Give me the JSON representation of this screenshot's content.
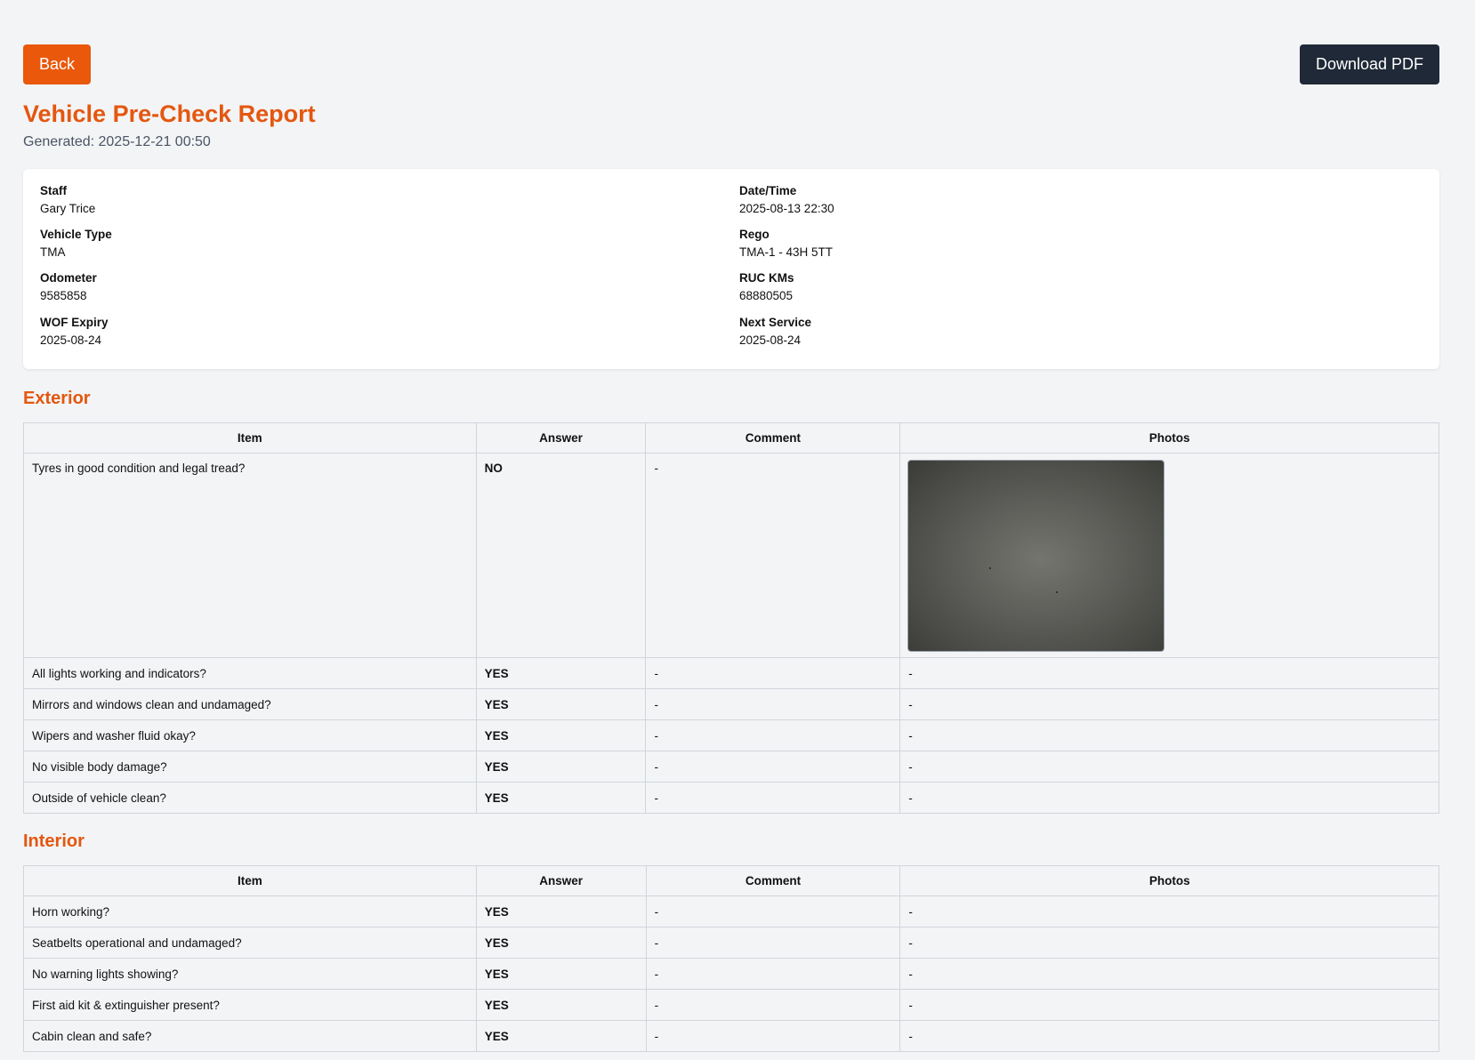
{
  "buttons": {
    "back": "Back",
    "download": "Download PDF"
  },
  "report": {
    "title": "Vehicle Pre-Check Report",
    "generated": "Generated: 2025-12-21 00:50"
  },
  "info": [
    {
      "label": "Staff",
      "value": "Gary Trice"
    },
    {
      "label": "Date/Time",
      "value": "2025-08-13 22:30"
    },
    {
      "label": "Vehicle Type",
      "value": "TMA"
    },
    {
      "label": "Rego",
      "value": "TMA-1 - 43H 5TT"
    },
    {
      "label": "Odometer",
      "value": "9585858"
    },
    {
      "label": "RUC KMs",
      "value": "68880505"
    },
    {
      "label": "WOF Expiry",
      "value": "2025-08-24"
    },
    {
      "label": "Next Service",
      "value": "2025-08-24"
    }
  ],
  "columns": [
    "Item",
    "Answer",
    "Comment",
    "Photos"
  ],
  "exterior": {
    "title": "Exterior",
    "rows": [
      {
        "item": "Tyres in good condition and legal tread?",
        "answer": "NO",
        "comment": "-",
        "photos": ""
      },
      {
        "item": "All lights working and indicators?",
        "answer": "YES",
        "comment": "-",
        "photos": "-"
      },
      {
        "item": "Mirrors and windows clean and undamaged?",
        "answer": "YES",
        "comment": "-",
        "photos": "-"
      },
      {
        "item": "Wipers and washer fluid okay?",
        "answer": "YES",
        "comment": "-",
        "photos": "-"
      },
      {
        "item": "No visible body damage?",
        "answer": "YES",
        "comment": "-",
        "photos": "-"
      },
      {
        "item": "Outside of vehicle clean?",
        "answer": "YES",
        "comment": "-",
        "photos": "-"
      }
    ]
  },
  "interior": {
    "title": "Interior",
    "rows": [
      {
        "item": "Horn working?",
        "answer": "YES",
        "comment": "-",
        "photos": "-"
      },
      {
        "item": "Seatbelts operational and undamaged?",
        "answer": "YES",
        "comment": "-",
        "photos": "-"
      },
      {
        "item": "No warning lights showing?",
        "answer": "YES",
        "comment": "-",
        "photos": "-"
      },
      {
        "item": "First aid kit & extinguisher present?",
        "answer": "YES",
        "comment": "-",
        "photos": "-"
      },
      {
        "item": "Cabin clean and safe?",
        "answer": "YES",
        "comment": "-",
        "photos": "-"
      }
    ]
  },
  "colors": {
    "accent": "#e4570f",
    "back_button": "#ea580c",
    "pdf_button": "#1f2937",
    "yes": "#15803d",
    "no": "#b91c1c"
  }
}
